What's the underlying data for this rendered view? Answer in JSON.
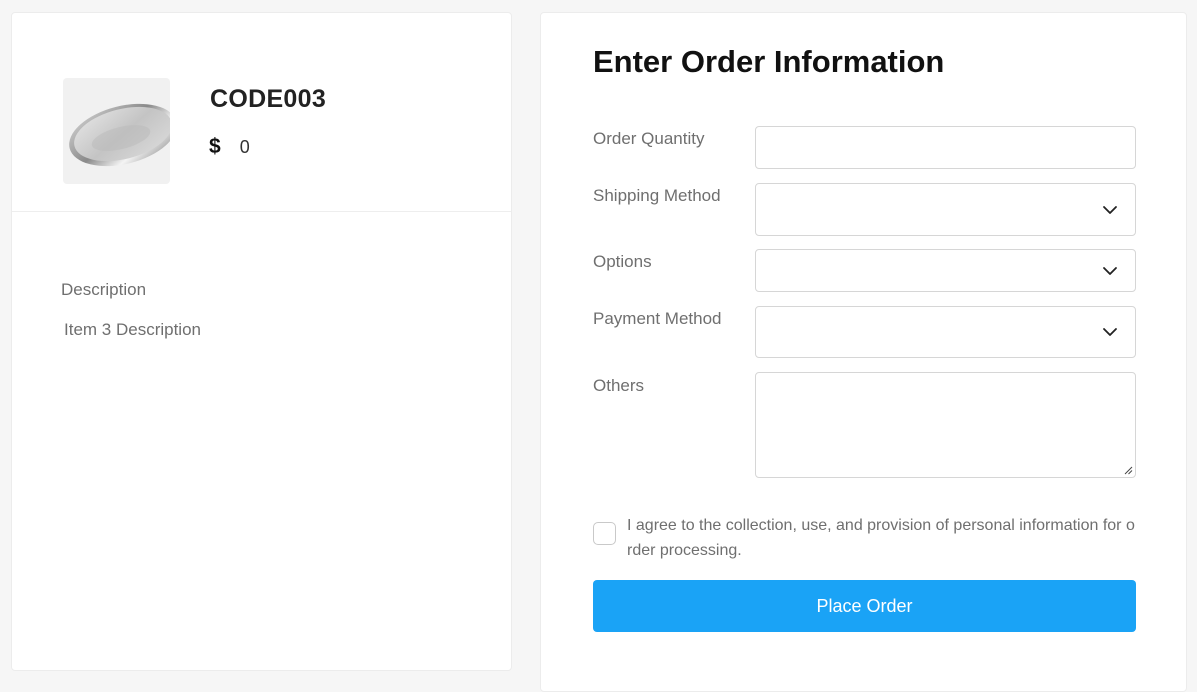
{
  "product": {
    "code": "CODE003",
    "currency_symbol": "$",
    "price": "0",
    "image_icon": "tray-image",
    "description_label": "Description",
    "description_text": "Item 3 Description"
  },
  "form": {
    "title": "Enter Order Information",
    "quantity": {
      "label": "Order Quantity",
      "value": ""
    },
    "shipping": {
      "label": "Shipping Method",
      "value": ""
    },
    "options": {
      "label": "Options",
      "value": ""
    },
    "payment": {
      "label": "Payment Method",
      "value": ""
    },
    "others": {
      "label": "Others",
      "value": ""
    },
    "agree_text": "I agree to the collection, use, and provision of personal information for order processing.",
    "agree_checked": false,
    "submit_label": "Place Order"
  },
  "colors": {
    "accent": "#1aa3f6",
    "label_gray": "#6f6f6f",
    "border": "#d6d6d6"
  }
}
